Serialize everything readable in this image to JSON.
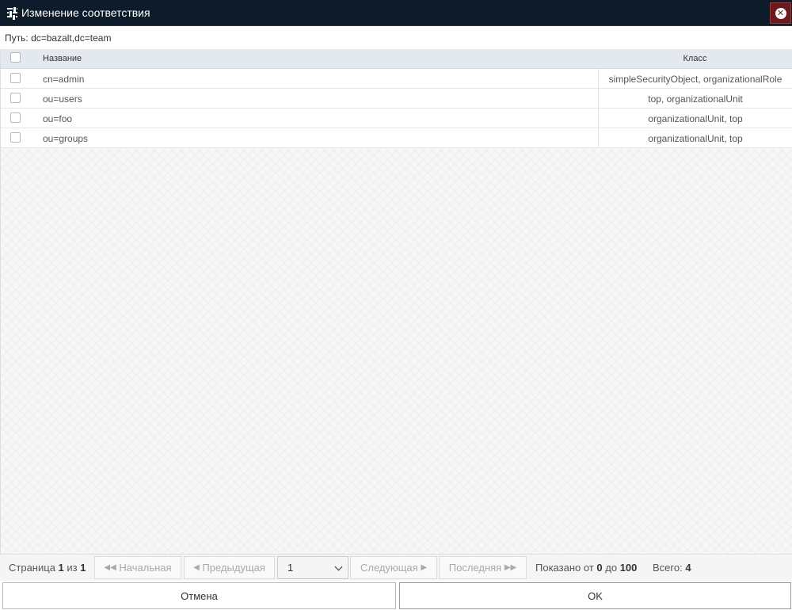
{
  "window": {
    "title": "Изменение соответствия",
    "icon": "sliders-icon",
    "close_icon": "close-circle-icon"
  },
  "path": {
    "label": "Путь:",
    "value": "dc=bazalt,dc=team"
  },
  "grid": {
    "columns": {
      "name": "Название",
      "class": "Класс"
    },
    "rows": [
      {
        "name": "cn=admin",
        "class": "simpleSecurityObject, organizationalRole"
      },
      {
        "name": "ou=users",
        "class": "top, organizationalUnit"
      },
      {
        "name": "ou=foo",
        "class": "organizationalUnit, top"
      },
      {
        "name": "ou=groups",
        "class": "organizationalUnit, top"
      }
    ]
  },
  "pager": {
    "page_label": "Страница",
    "page": "1",
    "of_label": "из",
    "pages": "1",
    "first": "Начальная",
    "prev": "Предыдущая",
    "next": "Следующая",
    "last": "Последняя",
    "page_select": "1",
    "shown_label": "Показано от",
    "shown_from": "0",
    "shown_to_label": "до",
    "shown_to": "100",
    "total_label": "Всего:",
    "total": "4"
  },
  "footer": {
    "cancel": "Отмена",
    "ok": "OK"
  }
}
